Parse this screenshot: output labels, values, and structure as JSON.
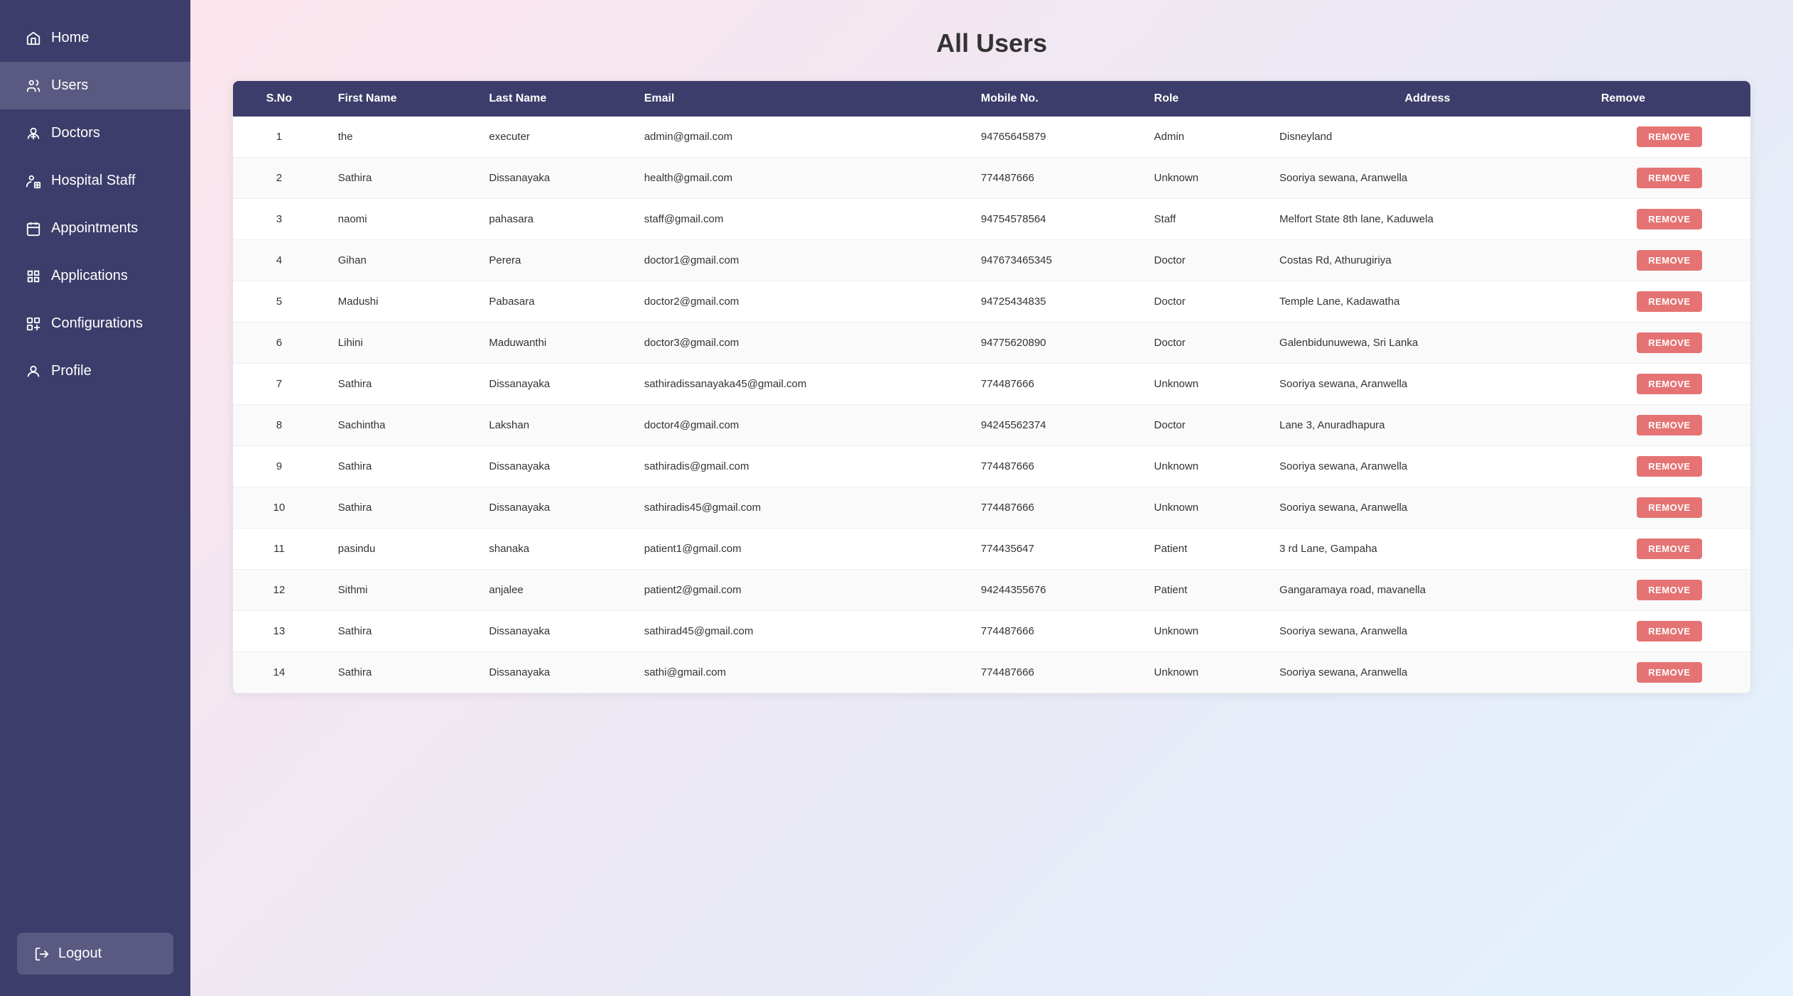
{
  "sidebar": {
    "items": [
      {
        "id": "home",
        "label": "Home",
        "icon": "home"
      },
      {
        "id": "users",
        "label": "Users",
        "icon": "users",
        "active": true
      },
      {
        "id": "doctors",
        "label": "Doctors",
        "icon": "doctors"
      },
      {
        "id": "hospital-staff",
        "label": "Hospital Staff",
        "icon": "hospital-staff"
      },
      {
        "id": "appointments",
        "label": "Appointments",
        "icon": "appointments"
      },
      {
        "id": "applications",
        "label": "Applications",
        "icon": "applications"
      },
      {
        "id": "configurations",
        "label": "Configurations",
        "icon": "configurations"
      },
      {
        "id": "profile",
        "label": "Profile",
        "icon": "profile"
      }
    ],
    "logout_label": "Logout"
  },
  "page": {
    "title": "All Users"
  },
  "table": {
    "columns": [
      "S.No",
      "First Name",
      "Last Name",
      "Email",
      "Mobile No.",
      "Role",
      "Address",
      "Remove"
    ],
    "rows": [
      {
        "sno": 1,
        "first": "the",
        "last": "executer",
        "email": "admin@gmail.com",
        "mobile": "94765645879",
        "role": "Admin",
        "address": "Disneyland"
      },
      {
        "sno": 2,
        "first": "Sathira",
        "last": "Dissanayaka",
        "email": "health@gmail.com",
        "mobile": "774487666",
        "role": "Unknown",
        "address": "Sooriya sewana, Aranwella"
      },
      {
        "sno": 3,
        "first": "naomi",
        "last": "pahasara",
        "email": "staff@gmail.com",
        "mobile": "94754578564",
        "role": "Staff",
        "address": "Melfort State 8th lane, Kaduwela"
      },
      {
        "sno": 4,
        "first": "Gihan",
        "last": "Perera",
        "email": "doctor1@gmail.com",
        "mobile": "947673465345",
        "role": "Doctor",
        "address": "Costas Rd, Athurugiriya"
      },
      {
        "sno": 5,
        "first": "Madushi",
        "last": "Pabasara",
        "email": "doctor2@gmail.com",
        "mobile": "94725434835",
        "role": "Doctor",
        "address": "Temple Lane, Kadawatha"
      },
      {
        "sno": 6,
        "first": "Lihini",
        "last": "Maduwanthi",
        "email": "doctor3@gmail.com",
        "mobile": "94775620890",
        "role": "Doctor",
        "address": "Galenbidunuwewa, Sri Lanka"
      },
      {
        "sno": 7,
        "first": "Sathira",
        "last": "Dissanayaka",
        "email": "sathiradissanayaka45@gmail.com",
        "mobile": "774487666",
        "role": "Unknown",
        "address": "Sooriya sewana, Aranwella"
      },
      {
        "sno": 8,
        "first": "Sachintha",
        "last": "Lakshan",
        "email": "doctor4@gmail.com",
        "mobile": "94245562374",
        "role": "Doctor",
        "address": "Lane 3, Anuradhapura"
      },
      {
        "sno": 9,
        "first": "Sathira",
        "last": "Dissanayaka",
        "email": "sathiradis@gmail.com",
        "mobile": "774487666",
        "role": "Unknown",
        "address": "Sooriya sewana, Aranwella"
      },
      {
        "sno": 10,
        "first": "Sathira",
        "last": "Dissanayaka",
        "email": "sathiradis45@gmail.com",
        "mobile": "774487666",
        "role": "Unknown",
        "address": "Sooriya sewana, Aranwella"
      },
      {
        "sno": 11,
        "first": "pasindu",
        "last": "shanaka",
        "email": "patient1@gmail.com",
        "mobile": "774435647",
        "role": "Patient",
        "address": "3 rd Lane, Gampaha"
      },
      {
        "sno": 12,
        "first": "Sithmi",
        "last": "anjalee",
        "email": "patient2@gmail.com",
        "mobile": "94244355676",
        "role": "Patient",
        "address": "Gangaramaya road, mavanella"
      },
      {
        "sno": 13,
        "first": "Sathira",
        "last": "Dissanayaka",
        "email": "sathirad45@gmail.com",
        "mobile": "774487666",
        "role": "Unknown",
        "address": "Sooriya sewana, Aranwella"
      },
      {
        "sno": 14,
        "first": "Sathira",
        "last": "Dissanayaka",
        "email": "sathi@gmail.com",
        "mobile": "774487666",
        "role": "Unknown",
        "address": "Sooriya sewana, Aranwella"
      }
    ],
    "remove_label": "REMOVE"
  }
}
